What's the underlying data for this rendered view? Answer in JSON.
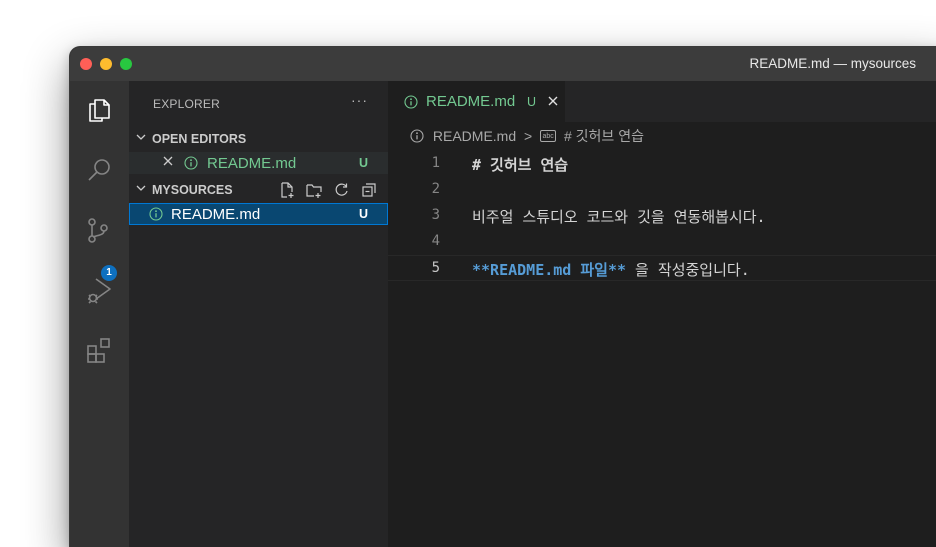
{
  "window": {
    "title": "README.md — mysources"
  },
  "activity_bar": {
    "items": [
      {
        "name": "explorer",
        "icon": "files-icon"
      },
      {
        "name": "search",
        "icon": "search-icon"
      },
      {
        "name": "source-control",
        "icon": "source-control-icon",
        "badge": "1"
      },
      {
        "name": "run-debug",
        "icon": "run-debug-icon"
      },
      {
        "name": "extensions",
        "icon": "extensions-icon"
      }
    ],
    "badge_color": "#0e70c0"
  },
  "sidebar": {
    "title": "EXPLORER",
    "more": "···",
    "open_editors": {
      "label": "OPEN EDITORS",
      "items": [
        {
          "file": "README.md",
          "status": "U"
        }
      ]
    },
    "folder": {
      "label": "MYSOURCES",
      "actions": [
        "new-file-icon",
        "new-folder-icon",
        "refresh-icon",
        "collapse-all-icon"
      ],
      "items": [
        {
          "file": "README.md",
          "status": "U"
        }
      ]
    }
  },
  "editor": {
    "tab": {
      "label": "README.md",
      "status": "U"
    },
    "breadcrumbs": {
      "file": "README.md",
      "separator": ">",
      "symbol": "# 깃허브 연습"
    },
    "lines": [
      {
        "n": "1",
        "heading": "# 깃허브 연습"
      },
      {
        "n": "2"
      },
      {
        "n": "3",
        "text": "비주얼 스튜디오 코드와 깃을 연동해봅시다."
      },
      {
        "n": "4"
      },
      {
        "n": "5",
        "bold": "**README.md 파일**",
        "rest": " 을 작성중입니다."
      }
    ],
    "current_line": "5"
  },
  "colors": {
    "untracked": "#73c991",
    "markdown_keyword": "#569cd6",
    "selection": "#094771",
    "focus_border": "#0078d4"
  }
}
